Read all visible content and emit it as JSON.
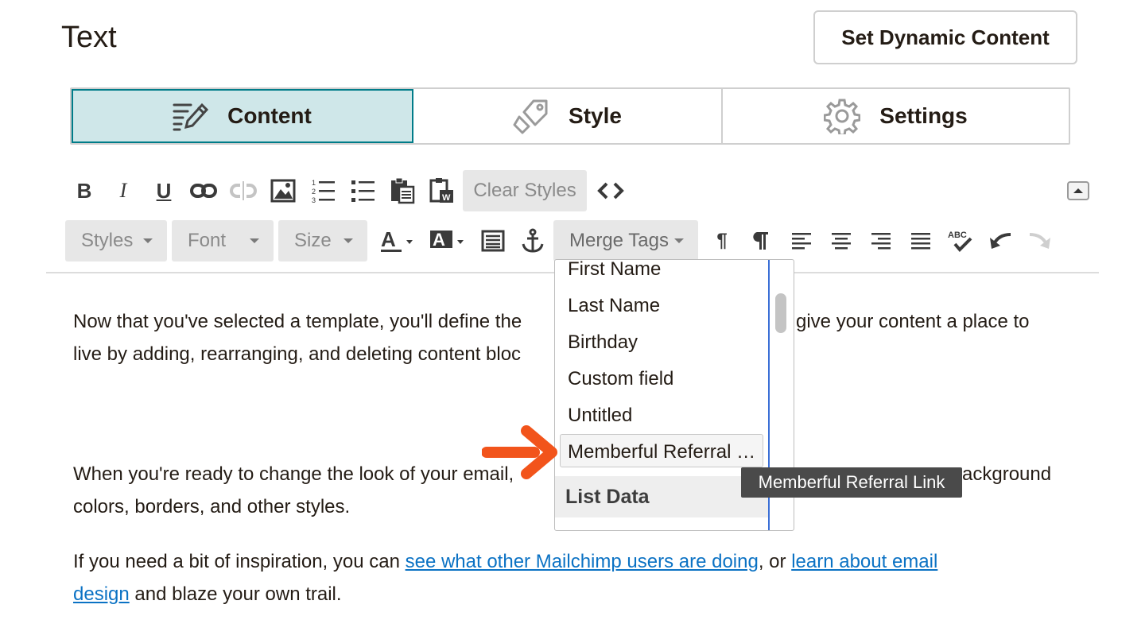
{
  "header": {
    "title": "Text",
    "dynamic_button": "Set Dynamic Content"
  },
  "tabs": [
    {
      "label": "Content",
      "icon": "edit-lines-icon",
      "active": true
    },
    {
      "label": "Style",
      "icon": "paint-tag-icon",
      "active": false
    },
    {
      "label": "Settings",
      "icon": "gear-icon",
      "active": false
    }
  ],
  "toolbar": {
    "row1_icons": [
      "bold-icon",
      "italic-icon",
      "underline-icon",
      "link-icon",
      "unlink-icon",
      "image-icon",
      "numbered-list-icon",
      "bulleted-list-icon",
      "paste-icon",
      "paste-word-icon"
    ],
    "bold": "B",
    "italic": "I",
    "underline": "U",
    "clear_styles": "Clear Styles",
    "source_icon": "code-icon",
    "collapse_icon": "collapse-up-icon",
    "styles": "Styles",
    "font": "Font",
    "size": "Size",
    "merge_tags": "Merge Tags",
    "row2_icons": [
      "text-color-icon",
      "background-color-icon",
      "block-icon",
      "anchor-icon",
      "ltr-icon",
      "rtl-icon",
      "align-left-icon",
      "align-center-icon",
      "align-right-icon",
      "justify-icon",
      "spellcheck-icon",
      "undo-icon",
      "redo-icon"
    ],
    "spellcheck_label": "ABC"
  },
  "content": {
    "p1_line1": "Now that you've selected a template, you'll define the",
    "p1_line1_end": "give your content a place to",
    "p1_line2": "live by adding, rearranging, and deleting content bloc",
    "p2_line1": "When you're ready to change the look of your email,",
    "p2_line1_end": "ackground",
    "p2_line2": "colors, borders, and other styles.",
    "p3_prefix": "If you need a bit of inspiration, you can ",
    "p3_link1": "see what other Mailchimp users are doing",
    "p3_mid": ", or ",
    "p3_link2a": "learn about email",
    "p3_link2b": "design",
    "p3_suffix": " and blaze your own trail."
  },
  "merge_menu": {
    "items": [
      "First Name",
      "Last Name",
      "Birthday",
      "Custom field",
      "Untitled",
      "Memberful Referral …"
    ],
    "section_header": "List Data",
    "tooltip": "Memberful Referral Link"
  },
  "colors": {
    "active_tab_bg": "#cfe7e9",
    "active_tab_border": "#007c89",
    "link": "#0b72c4",
    "arrow": "#f2541b",
    "focus_border": "#3b6fd6"
  }
}
